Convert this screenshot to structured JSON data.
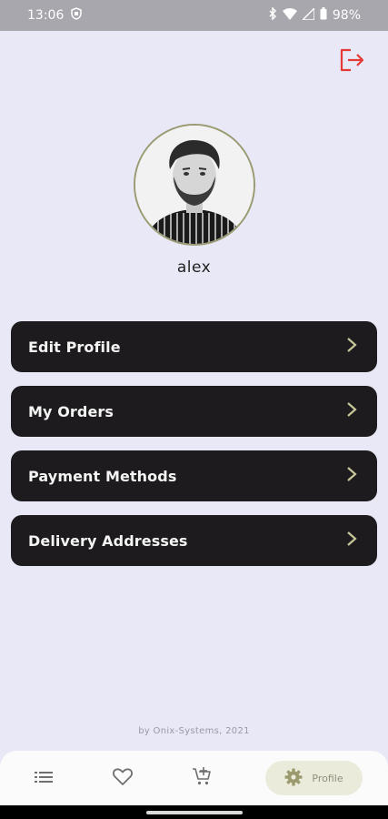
{
  "status_bar": {
    "time": "13:06",
    "battery_percent": "98%"
  },
  "profile": {
    "username": "alex"
  },
  "menu": {
    "items": [
      {
        "label": "Edit Profile"
      },
      {
        "label": "My Orders"
      },
      {
        "label": "Payment Methods"
      },
      {
        "label": "Delivery Addresses"
      }
    ]
  },
  "footer": {
    "credit": "by Onix-Systems, 2021"
  },
  "bottom_nav": {
    "items": [
      {
        "icon": "list-icon"
      },
      {
        "icon": "heart-icon"
      },
      {
        "icon": "cart-add-icon"
      },
      {
        "icon": "gear-icon",
        "label": "Profile"
      }
    ]
  },
  "colors": {
    "background": "#e9e8f6",
    "menu_item": "#1d1b1d",
    "chevron": "#c8c79a",
    "logout": "#e53935",
    "active_tab": "#ebebdc"
  }
}
